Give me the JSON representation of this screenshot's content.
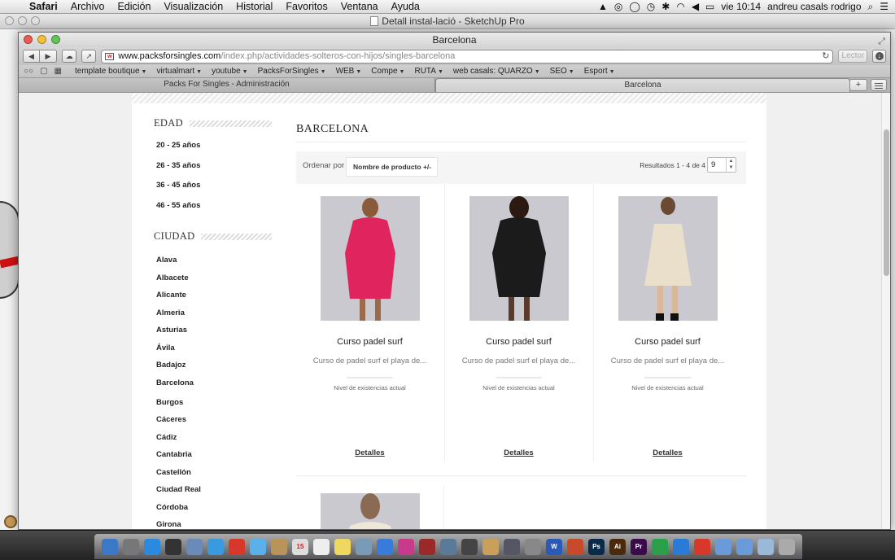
{
  "menubar": {
    "app": "Safari",
    "items": [
      "Archivo",
      "Edición",
      "Visualización",
      "Historial",
      "Favoritos",
      "Ventana",
      "Ayuda"
    ],
    "clock": "vie 10:14",
    "user": "andreu casals rodrigo"
  },
  "background_window": {
    "title": "Detall instal-lació - SketchUp Pro"
  },
  "safari": {
    "window_title": "Barcelona",
    "url_host": "www.packsforsingles.com",
    "url_path": "/index.php/actividades-solteros-con-hijos/singles-barcelona",
    "reader_label": "Lector",
    "bookmarks": [
      {
        "label": "template boutique",
        "menu": true
      },
      {
        "label": "virtualmart",
        "menu": true
      },
      {
        "label": "youtube",
        "menu": true
      },
      {
        "label": "PacksForSingles",
        "menu": true
      },
      {
        "label": "WEB",
        "menu": true
      },
      {
        "label": "Compe",
        "menu": true
      },
      {
        "label": "RUTA",
        "menu": true
      },
      {
        "label": "web casals: QUARZO",
        "menu": true
      },
      {
        "label": "SEO",
        "menu": true
      },
      {
        "label": "Esport",
        "menu": true
      }
    ],
    "tabs": [
      {
        "label": "Packs For Singles - Administración",
        "active": false
      },
      {
        "label": "Barcelona",
        "active": true
      }
    ],
    "new_tab_label": "+"
  },
  "sidebar": {
    "edad_heading": "EDAD",
    "edad": [
      "20 - 25 años",
      "26 - 35 años",
      "36 - 45 años",
      "46 - 55 años"
    ],
    "ciudad_heading": "CIUDAD",
    "ciudades": [
      "Alava",
      "Albacete",
      "Alicante",
      "Almeria",
      "Asturias",
      "Ávila",
      "Badajoz",
      "Barcelona",
      "Burgos",
      "Cáceres",
      "Cádiz",
      "Cantabria",
      "Castellón",
      "Ciudad Real",
      "Córdoba",
      "Girona"
    ]
  },
  "main": {
    "title": "BARCELONA",
    "sort_label": "Ordenar por",
    "sort_value": "Nombre de producto +/-",
    "results": "Resultados 1 - 4 de 4",
    "per_page": "9",
    "products": [
      {
        "name": "Curso padel surf",
        "desc": "Curso de padel surf el playa de...",
        "stock_label": "Nivel de existencias actual",
        "details": "Detalles",
        "dress_color": "#e0245e"
      },
      {
        "name": "Curso padel surf",
        "desc": "Curso de padel surf el playa de...",
        "stock_label": "Nivel de existencias actual",
        "details": "Detalles",
        "dress_color": "#1b1b1b"
      },
      {
        "name": "Curso padel surf",
        "desc": "Curso de padel surf el playa de...",
        "stock_label": "Nivel de existencias actual",
        "details": "Detalles",
        "dress_color": "#eadfcb"
      }
    ]
  },
  "dock": {
    "apps": [
      {
        "icon": "finder-icon",
        "label": "",
        "color": "#3b78c8"
      },
      {
        "icon": "launchpad-icon",
        "label": "",
        "color": "#777"
      },
      {
        "icon": "app-store-icon",
        "label": "",
        "color": "#2a8ae0"
      },
      {
        "icon": "dashboard-icon",
        "label": "",
        "color": "#333"
      },
      {
        "icon": "mail-icon",
        "label": "",
        "color": "#6a8ab8"
      },
      {
        "icon": "safari-icon",
        "label": "",
        "color": "#3a9ae0"
      },
      {
        "icon": "chrome-icon",
        "label": "",
        "color": "#d8382a"
      },
      {
        "icon": "messages-icon",
        "label": "",
        "color": "#5ab0e8"
      },
      {
        "icon": "contacts-icon",
        "label": "",
        "color": "#b8945a"
      },
      {
        "icon": "calendar-icon",
        "label": "15",
        "color": "#ddd"
      },
      {
        "icon": "textedit-icon",
        "label": "",
        "color": "#eee"
      },
      {
        "icon": "notes-icon",
        "label": "",
        "color": "#f0d860"
      },
      {
        "icon": "preview-icon",
        "label": "",
        "color": "#7a9ab8"
      },
      {
        "icon": "itunes-icon",
        "label": "",
        "color": "#3a7ad8"
      },
      {
        "icon": "music-icon",
        "label": "",
        "color": "#c83a8a"
      },
      {
        "icon": "photo-booth-icon",
        "label": "",
        "color": "#9a2a2a"
      },
      {
        "icon": "iphoto-icon",
        "label": "",
        "color": "#5a7a9a"
      },
      {
        "icon": "imovie-icon",
        "label": "",
        "color": "#444"
      },
      {
        "icon": "garageband-icon",
        "label": "",
        "color": "#c8a05a"
      },
      {
        "icon": "time-machine-icon",
        "label": "",
        "color": "#556"
      },
      {
        "icon": "screenshot-icon",
        "label": "",
        "color": "#888"
      },
      {
        "icon": "word-icon",
        "label": "W",
        "color": "#2a5ab8"
      },
      {
        "icon": "powerpoint-icon",
        "label": "",
        "color": "#c84a2a"
      },
      {
        "icon": "photoshop-icon",
        "label": "Ps",
        "color": "#0a2a4a"
      },
      {
        "icon": "illustrator-icon",
        "label": "Ai",
        "color": "#4a2a0a"
      },
      {
        "icon": "premiere-icon",
        "label": "Pr",
        "color": "#3a0a4a"
      },
      {
        "icon": "google-drive-icon",
        "label": "",
        "color": "#2aa04a"
      },
      {
        "icon": "dropbox-icon",
        "label": "",
        "color": "#2a7ad8"
      },
      {
        "icon": "sketchup-icon",
        "label": "",
        "color": "#d8382a"
      },
      {
        "icon": "folder-icon",
        "label": "",
        "color": "#6a9ad8"
      },
      {
        "icon": "downloads-icon",
        "label": "",
        "color": "#6a9ad8"
      },
      {
        "icon": "documents-icon",
        "label": "",
        "color": "#9ab8d8"
      },
      {
        "icon": "trash-icon",
        "label": "",
        "color": "#aaa"
      }
    ]
  }
}
